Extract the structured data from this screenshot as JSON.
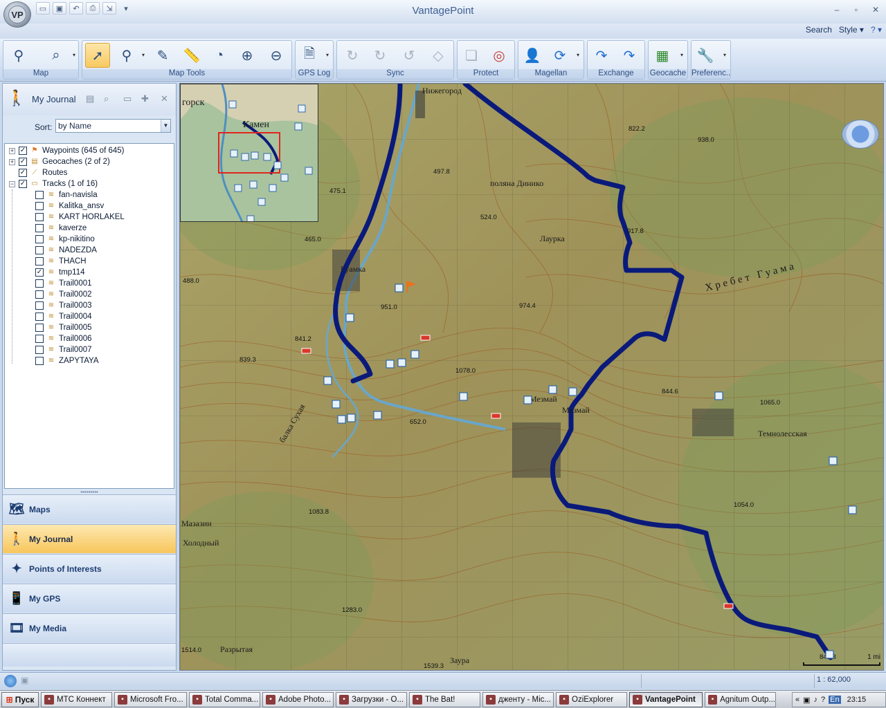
{
  "app": {
    "title": "VantagePoint",
    "logo": "VP"
  },
  "quick_access": [
    "folder-open-icon",
    "save-icon",
    "undo-icon",
    "print-icon",
    "export-icon"
  ],
  "window_controls": {
    "minimize": "–",
    "maximize": "▫",
    "close": "✕"
  },
  "top_menu": {
    "search": "Search",
    "style": "Style ▾",
    "help": "? ▾"
  },
  "ribbon_groups": [
    {
      "label": "Map"
    },
    {
      "label": "Map Tools"
    },
    {
      "label": "GPS Log"
    },
    {
      "label": "Sync"
    },
    {
      "label": "Protect"
    },
    {
      "label": "Magellan"
    },
    {
      "label": "Exchange"
    },
    {
      "label": "Geocache"
    },
    {
      "label": "Preferenc.."
    }
  ],
  "journal": {
    "title": "My Journal",
    "sort_label": "Sort:",
    "sort_value": "by Name",
    "close": "✕"
  },
  "tree": [
    {
      "label": "Waypoints (645 of 645)",
      "level": 0,
      "exp": "+",
      "checked": true,
      "icon": "flag-icon"
    },
    {
      "label": "Geocaches (2 of 2)",
      "level": 0,
      "exp": "+",
      "checked": true,
      "icon": "geocache-icon"
    },
    {
      "label": "Routes",
      "level": 0,
      "exp": "",
      "checked": true,
      "icon": "route-icon"
    },
    {
      "label": "Tracks (1 of 16)",
      "level": 0,
      "exp": "−",
      "checked": true,
      "icon": "track-folder-icon"
    },
    {
      "label": "fan-navisla",
      "level": 1,
      "checked": false
    },
    {
      "label": "Kalitka_ansv",
      "level": 1,
      "checked": false
    },
    {
      "label": "KART HORLAKEL",
      "level": 1,
      "checked": false
    },
    {
      "label": "kaverze",
      "level": 1,
      "checked": false
    },
    {
      "label": "kp-nikitino",
      "level": 1,
      "checked": false
    },
    {
      "label": "NADEZDA",
      "level": 1,
      "checked": false
    },
    {
      "label": "THACH",
      "level": 1,
      "checked": false
    },
    {
      "label": "tmp114",
      "level": 1,
      "checked": true
    },
    {
      "label": "Trail0001",
      "level": 1,
      "checked": false
    },
    {
      "label": "Trail0002",
      "level": 1,
      "checked": false
    },
    {
      "label": "Trail0003",
      "level": 1,
      "checked": false
    },
    {
      "label": "Trail0004",
      "level": 1,
      "checked": false
    },
    {
      "label": "Trail0005",
      "level": 1,
      "checked": false
    },
    {
      "label": "Trail0006",
      "level": 1,
      "checked": false
    },
    {
      "label": "Trail0007",
      "level": 1,
      "checked": false
    },
    {
      "label": "ZAPYTAYA",
      "level": 1,
      "checked": false
    }
  ],
  "nav": [
    {
      "label": "Maps",
      "icon": "maps-icon",
      "active": false
    },
    {
      "label": "My Journal",
      "icon": "journal-icon",
      "active": true
    },
    {
      "label": "Points of Interests",
      "icon": "poi-icon",
      "active": false
    },
    {
      "label": "My GPS",
      "icon": "gps-icon",
      "active": false
    },
    {
      "label": "My Media",
      "icon": "media-icon",
      "active": false
    }
  ],
  "map": {
    "overview_label": "горск",
    "overview_label2": "Камен",
    "labels": [
      {
        "t": "Нижегород"
      },
      {
        "t": "Гуамка"
      },
      {
        "t": "Мезмай"
      },
      {
        "t": "Темнолесская"
      },
      {
        "t": "Хребет Гуама"
      },
      {
        "t": "Мазазин"
      },
      {
        "t": "Холодный"
      },
      {
        "t": "Разрытая"
      },
      {
        "t": "Заура"
      },
      {
        "t": "балка Сухая"
      },
      {
        "t": "поляна Динико"
      },
      {
        "t": "Лаурка"
      },
      {
        "t": "Мезмай"
      }
    ],
    "elev": [
      "475.1",
      "497.8",
      "465.0",
      "488.0",
      "951.0",
      "974.4",
      "841.2",
      "839.3",
      "1078.0",
      "652.0",
      "1083.8",
      "1283.0",
      "1539.3",
      "1514.0",
      "524.0",
      "917.8",
      "822.2",
      "938.0",
      "844.6",
      "1065.0",
      "1054.0",
      "842.8"
    ],
    "scale_label": "1 mi",
    "accent": "#0a1a7a"
  },
  "status": {
    "zoom": "1 : 62,000"
  },
  "taskbar": {
    "start": "Пуск",
    "tasks": [
      {
        "label": "МТС Коннект",
        "w": 103
      },
      {
        "label": "Microsoft Fro...",
        "w": 105
      },
      {
        "label": "Total Comma...",
        "w": 103
      },
      {
        "label": "Adobe Photo...",
        "w": 103
      },
      {
        "label": "Загрузки - О...",
        "w": 103
      },
      {
        "label": "The Bat!",
        "w": 103
      },
      {
        "label": "дженту - Mic...",
        "w": 103
      },
      {
        "label": "OziExplorer",
        "w": 103
      },
      {
        "label": "VantagePoint",
        "w": 106,
        "active": true
      },
      {
        "label": "Agnitum Outp...",
        "w": 103
      }
    ],
    "tray_lang": "En",
    "clock": "23:15"
  }
}
